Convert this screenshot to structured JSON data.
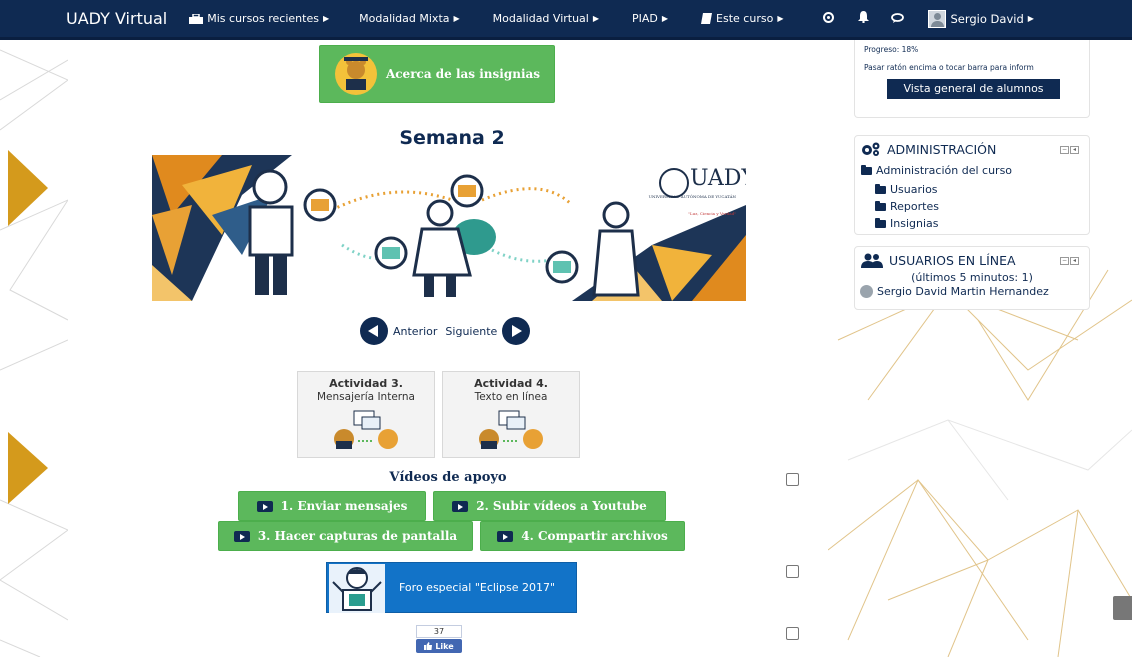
{
  "navbar": {
    "brand": "UADY Virtual",
    "items": [
      {
        "label": "Mis cursos recientes",
        "icon": "courses-icon"
      },
      {
        "label": "Modalidad Mixta"
      },
      {
        "label": "Modalidad Virtual"
      },
      {
        "label": "PIAD"
      },
      {
        "label": "Este curso",
        "icon": "book-icon"
      }
    ],
    "icons": [
      "dashboard-icon",
      "notifications-icon",
      "messages-icon"
    ],
    "user": "Sergio David"
  },
  "main": {
    "badges_button": "Acerca de las insignias",
    "week_title": "Semana 2",
    "banner_logo": {
      "name": "UADY",
      "subtitle": "UNIVERSIDAD AUTÓNOMA DE YUCATÁN",
      "motto": "\"Luz, Ciencia y Verdad\""
    },
    "pagination": {
      "prev": "Anterior",
      "next": "Siguiente"
    },
    "activities": [
      {
        "title": "Actividad 3.",
        "subtitle": "Mensajería Interna"
      },
      {
        "title": "Actividad 4.",
        "subtitle": "Texto en línea"
      }
    ],
    "videos_title": "Vídeos de apoyo",
    "videos": [
      "1. Enviar mensajes",
      "2. Subir vídeos a Youtube",
      "3. Hacer capturas de pantalla",
      "4. Compartir archivos"
    ],
    "forum_button": "Foro especial \"Eclipse 2017\"",
    "fb_like": {
      "count": "37",
      "label": "Like"
    }
  },
  "sidebar": {
    "progress": {
      "text": "Progreso: 18%",
      "hint": "Pasar ratón encima o tocar barra para inform",
      "overview_button": "Vista general de alumnos"
    },
    "admin": {
      "title": "ADMINISTRACIÓN",
      "course_admin": "Administración del curso",
      "items": [
        "Usuarios",
        "Reportes",
        "Insignias"
      ]
    },
    "online": {
      "title": "USUARIOS EN LÍNEA",
      "subtitle": "(últimos 5 minutos: 1)",
      "users": [
        "Sergio David Martin Hernandez"
      ]
    }
  },
  "colors": {
    "navbar": "#0f2a52",
    "accent_green": "#5cb85c",
    "forum_blue": "#1273c8",
    "gold": "#d4a017"
  }
}
